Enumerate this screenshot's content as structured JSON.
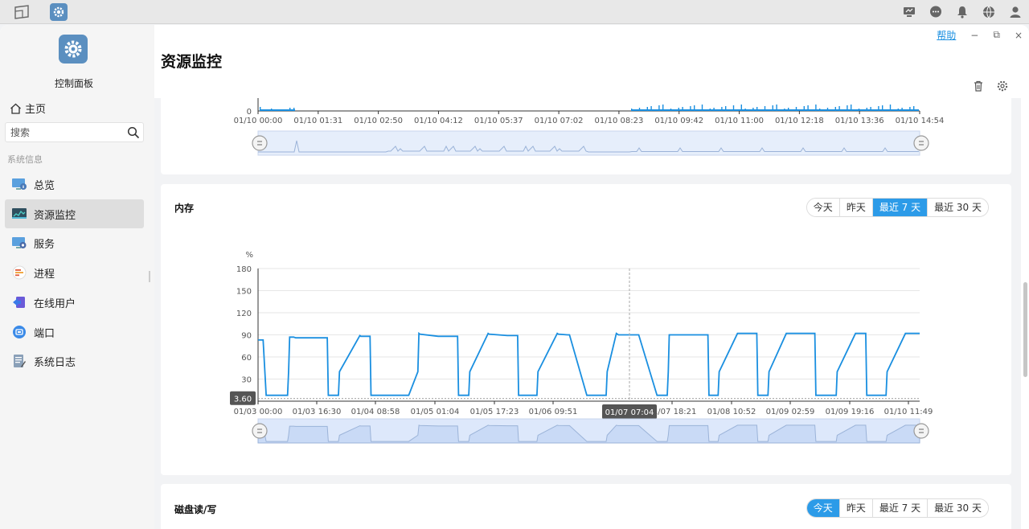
{
  "sidebar": {
    "app_title": "控制面板",
    "home": "主页",
    "search_placeholder": "搜索",
    "section_label": "系统信息",
    "items": [
      {
        "label": "总览",
        "icon": "monitor-info-icon"
      },
      {
        "label": "资源监控",
        "icon": "resource-monitor-icon"
      },
      {
        "label": "服务",
        "icon": "service-icon"
      },
      {
        "label": "进程",
        "icon": "process-icon"
      },
      {
        "label": "在线用户",
        "icon": "online-user-icon"
      },
      {
        "label": "端口",
        "icon": "port-icon"
      },
      {
        "label": "系统日志",
        "icon": "system-log-icon"
      }
    ]
  },
  "window": {
    "help": "帮助",
    "minimize": "−",
    "restore": "⧉",
    "close": "×"
  },
  "page": {
    "title": "资源监控"
  },
  "memory_card": {
    "title": "内存",
    "ranges": [
      "今天",
      "昨天",
      "最近 7 天",
      "最近 30 天"
    ],
    "selected": "最近 7 天",
    "unit": "%",
    "hover_value": "3.60",
    "hover_time": "01/07 07:04"
  },
  "disk_card": {
    "title": "磁盘读/写",
    "ranges": [
      "今天",
      "昨天",
      "最近 7 天",
      "最近 30 天"
    ],
    "selected": "今天"
  },
  "colors": {
    "accent": "#2c9be8",
    "line": "#1a8fe0"
  },
  "chart_data": [
    {
      "type": "line",
      "title": "",
      "x_ticks": [
        "01/10 00:00",
        "01/10 01:31",
        "01/10 02:50",
        "01/10 04:12",
        "01/10 05:37",
        "01/10 07:02",
        "01/10 08:23",
        "01/10 09:42",
        "01/10 11:00",
        "01/10 12:18",
        "01/10 13:36",
        "01/10 14:54"
      ],
      "y_ticks": [
        "0"
      ],
      "series": [
        {
          "values": []
        }
      ]
    },
    {
      "type": "line",
      "title": "内存",
      "ylabel": "%",
      "ylim": [
        0,
        180
      ],
      "y_ticks": [
        "180",
        "150",
        "120",
        "90",
        "60",
        "30",
        "0"
      ],
      "x_ticks": [
        "01/03 00:00",
        "01/03 16:30",
        "01/04 08:58",
        "01/05 01:04",
        "01/05 17:23",
        "01/06 09:51",
        "01/07 18:21",
        "01/08 10:52",
        "01/09 02:59",
        "01/09 19:16",
        "01/10 11:49"
      ],
      "grid": true,
      "x": [
        0,
        0.05,
        0.08,
        0.16,
        0.29,
        0.3,
        0.31,
        0.35,
        0.37,
        0.38,
        0.68,
        0.69,
        0.78,
        0.79,
        0.8,
        1.0,
        1.01,
        1.09,
        1.1,
        1.11,
        1.47,
        1.48,
        1.57,
        1.58,
        1.59,
        1.77,
        1.78,
        1.96,
        1.97,
        2.06,
        2.07,
        2.08,
        2.26,
        2.27,
        2.45,
        2.46,
        2.55,
        2.56,
        2.57,
        2.74,
        2.75,
        2.94,
        2.95,
        3.04,
        3.05,
        3.06,
        3.23,
        3.24,
        3.42,
        3.43,
        3.52,
        3.53,
        3.54,
        3.73,
        3.74,
        3.92,
        3.93,
        4.02,
        4.03,
        4.04,
        4.23,
        4.24,
        4.42,
        4.43,
        4.51,
        4.52,
        4.53,
        4.71,
        4.72,
        4.9,
        4.91,
        5.0,
        5.01,
        5.02,
        5.19,
        5.2,
        5.38,
        5.39,
        5.47,
        5.48,
        5.49,
        5.68,
        5.69,
        5.87,
        5.88,
        5.97,
        5.98,
        5.99,
        6.17,
        6.18,
        6.36,
        6.37,
        6.44,
        6.45,
        6.5
      ],
      "y": [
        83,
        83,
        8,
        8,
        8,
        40,
        87,
        87,
        86,
        86,
        86,
        8,
        8,
        8,
        40,
        89,
        88,
        88,
        88,
        8,
        8,
        8,
        40,
        92,
        91,
        88,
        88,
        88,
        8,
        8,
        8,
        40,
        92,
        91,
        89,
        89,
        89,
        8,
        8,
        8,
        40,
        92,
        91,
        90,
        90,
        90,
        8,
        8,
        8,
        40,
        92,
        91,
        90,
        90,
        90,
        8,
        8,
        8,
        40,
        90,
        90,
        90,
        90,
        8,
        8,
        8,
        40,
        92,
        92,
        92,
        8,
        8,
        8,
        40,
        92,
        92,
        92,
        92,
        92,
        8,
        8,
        8,
        40,
        92,
        92,
        92,
        8,
        8,
        8,
        40,
        92,
        92,
        92,
        92,
        92
      ]
    }
  ]
}
